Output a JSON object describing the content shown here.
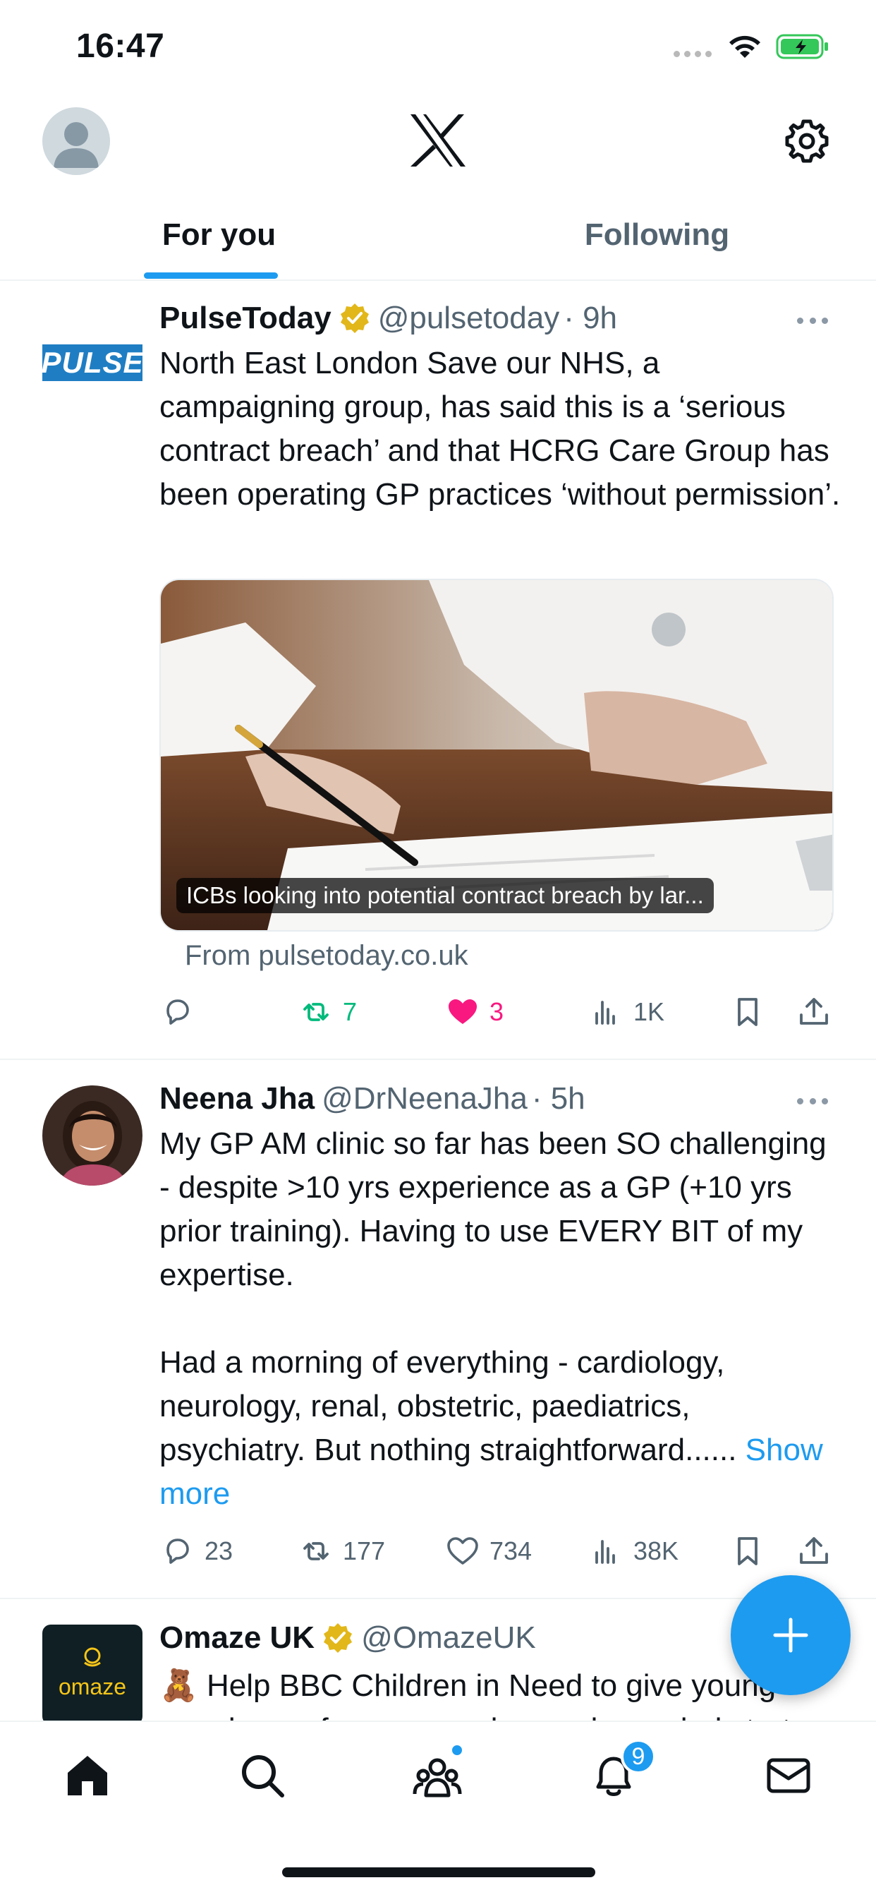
{
  "status": {
    "time": "16:47"
  },
  "header": {
    "tabs": [
      {
        "label": "For you",
        "active": true
      },
      {
        "label": "Following",
        "active": false
      }
    ]
  },
  "tweets": [
    {
      "author": "PulseToday",
      "verified": true,
      "handle": "@pulsetoday",
      "time": "· 9h",
      "avatar_text": "PULSE",
      "text": "North East London Save our NHS, a campaigning group, has said this is a ‘serious contract breach’ and that HCRG Care Group has been operating GP practices ‘without permission’.",
      "media_caption": "ICBs looking into potential contract breach by lar...",
      "link_source": "From pulsetoday.co.uk",
      "actions": {
        "replies": "",
        "reposts": "7",
        "likes": "3",
        "views": "1K"
      },
      "liked": true,
      "reposted": true
    },
    {
      "author": "Neena Jha",
      "verified": false,
      "handle": "@DrNeenaJha",
      "time": "· 5h",
      "text_p1": "My GP AM clinic so far has been SO challenging - despite >10 yrs experience as a GP (+10 yrs prior training). Having to use EVERY BIT of my expertise.",
      "text_p2": "Had a morning of everything - cardiology, neurology, renal, obstetric, paediatrics, psychiatry. But nothing straightforward...... ",
      "show_more": "Show more",
      "actions": {
        "replies": "23",
        "reposts": "177",
        "likes": "734",
        "views": "38K"
      }
    },
    {
      "author": "Omaze UK",
      "verified": true,
      "handle": "@OmazeUK",
      "avatar_text": "omaze",
      "text": "🧸 Help BBC Children in Need to give young people a safe space and a much-needed start"
    }
  ],
  "nav": {
    "notifications_badge": "9"
  },
  "colors": {
    "accent": "#1d9bf0",
    "repost": "#00ba7c",
    "like": "#f91880",
    "verified_gold": "#e2b719"
  }
}
